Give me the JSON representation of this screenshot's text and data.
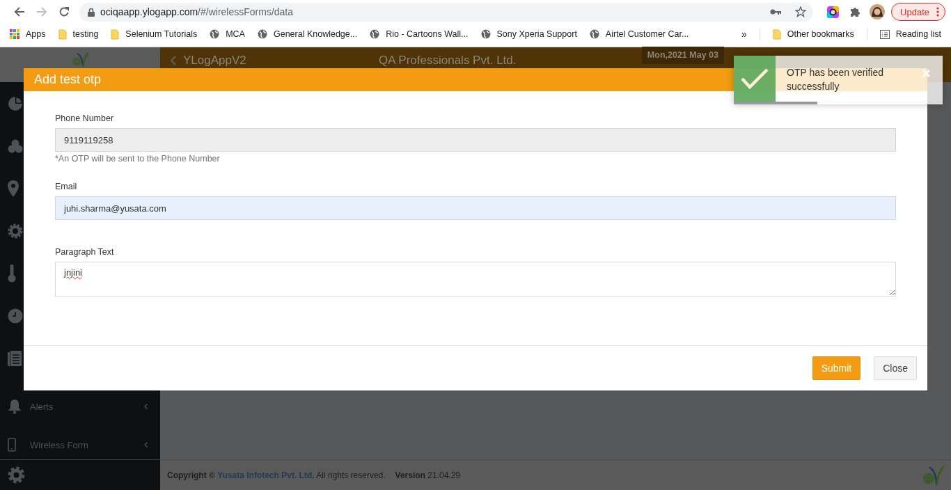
{
  "browser": {
    "forward_enabled": false,
    "url_host": "ociqaapp.ylogapp.com",
    "url_path": "/#/wirelessForms/data",
    "update_button": "Update",
    "bookmarks": [
      {
        "label": "Apps",
        "kind": "apps"
      },
      {
        "label": "testing",
        "kind": "folder"
      },
      {
        "label": "Selenium Tutorials",
        "kind": "folder"
      },
      {
        "label": "MCA",
        "kind": "site"
      },
      {
        "label": "General Knowledge...",
        "kind": "site"
      },
      {
        "label": "Rio - Cartoons Wall...",
        "kind": "site"
      },
      {
        "label": "Sony Xperia Support",
        "kind": "site"
      },
      {
        "label": "Airtel Customer Car...",
        "kind": "site"
      }
    ],
    "overflow": "»",
    "other_bookmarks": "Other bookmarks",
    "reading_list": "Reading list"
  },
  "header": {
    "brand": "YLogAppV2",
    "company": "QA Professionals Pvt. Ltd.",
    "date": "Mon,2021 May 03"
  },
  "sidebar": {
    "icon_items": [
      {
        "kind": "pie"
      },
      {
        "kind": "cluster"
      },
      {
        "kind": "pin"
      },
      {
        "kind": "badge"
      },
      {
        "kind": "thermometer"
      },
      {
        "kind": "clock"
      },
      {
        "kind": "document"
      }
    ],
    "items": [
      {
        "label": "Alerts",
        "kind": "bell"
      },
      {
        "label": "Wireless Form",
        "kind": "phone"
      }
    ]
  },
  "footer": {
    "copyright": "Copyright ©",
    "company": "Yusata Infotech Pvt. Ltd.",
    "rights": "All rights reserved.",
    "version_label": "Version",
    "version": "21.04.29"
  },
  "modal": {
    "title": "Add test otp",
    "fields": [
      {
        "label": "Phone Number",
        "kind": "input",
        "value": "9119119258",
        "readonly": true,
        "autofilled": false,
        "hint": "*An OTP will be sent to the Phone Number"
      },
      {
        "label": "Email",
        "kind": "input",
        "value": "juhi.sharma@yusata.com",
        "readonly": false,
        "autofilled": true
      },
      {
        "label": "Paragraph Text",
        "kind": "textarea",
        "value": "jnjini",
        "readonly": false,
        "autofilled": false
      }
    ],
    "buttons": [
      {
        "label": "Submit",
        "kind": "primary"
      },
      {
        "label": "Close",
        "kind": "secondary"
      }
    ]
  },
  "toast": {
    "kind": "success",
    "message": "OTP has been verified successfully",
    "level": 0.4
  }
}
